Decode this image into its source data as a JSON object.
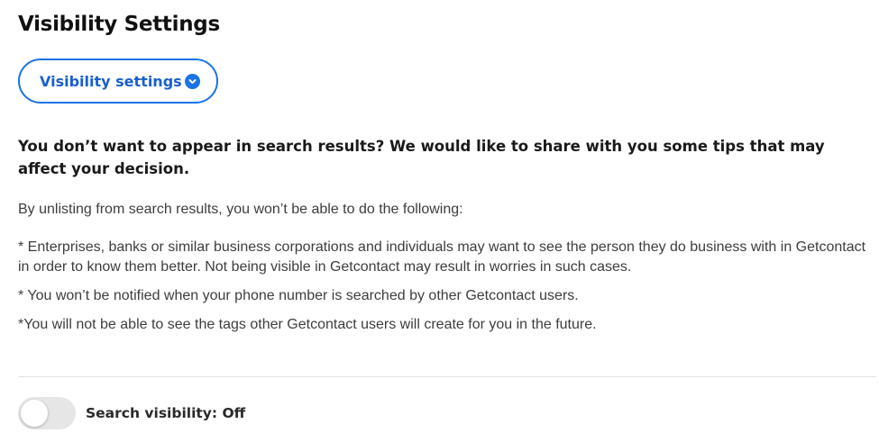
{
  "page": {
    "title": "Visibility Settings"
  },
  "dropdown": {
    "label": "Visibility settings",
    "icon": "chevron-down-circle-icon",
    "accent_color": "#1a73e8"
  },
  "content": {
    "headline": "You don’t want to appear in search results? We would like to share with you some tips that may affect your decision.",
    "intro": "By unlisting from search results, you won’t be able to do the following:",
    "tips": [
      "* Enterprises, banks or similar business corporations and individuals may want to see the person they do business with in Getcontact in order to know them better. Not being visible in Getcontact may result in worries in such cases.",
      "* You won’t be notified when your phone number is searched by other Getcontact users.",
      "*You will not be able to see the tags other Getcontact users will create for you in the future."
    ]
  },
  "visibility_toggle": {
    "label": "Search visibility: Off",
    "state": "off"
  }
}
